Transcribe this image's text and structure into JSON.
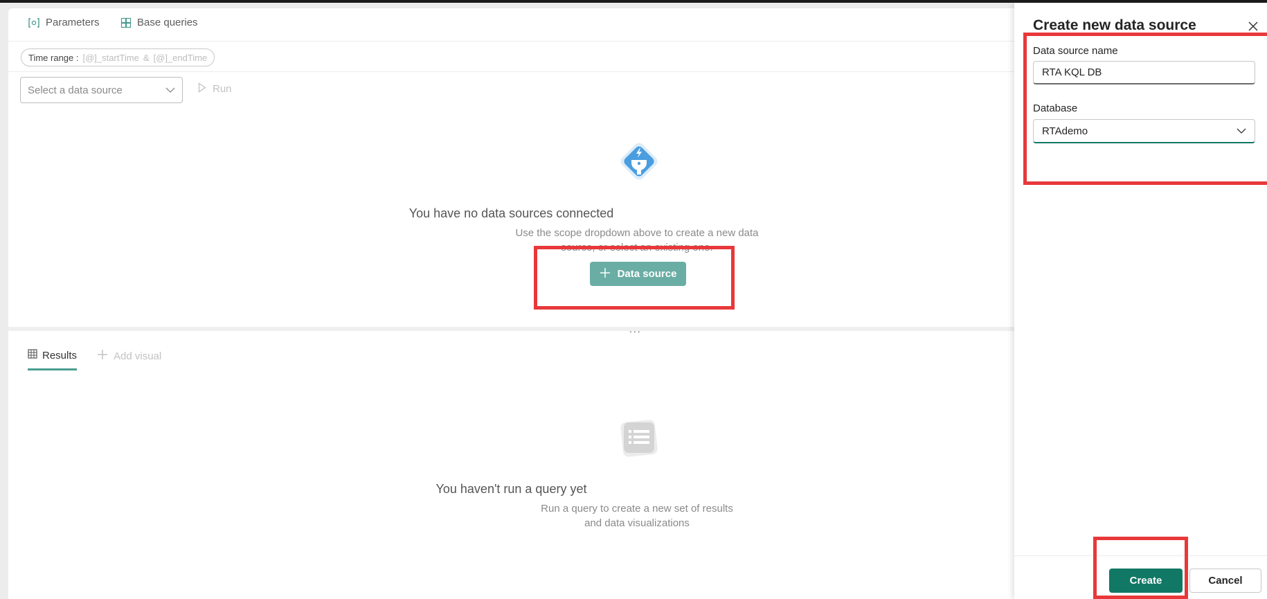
{
  "tabs": {
    "parameters_label": "Parameters",
    "base_queries_label": "Base queries"
  },
  "time_range": {
    "label": "Time range :",
    "start_placeholder": "[@]_startTime",
    "separator": "&",
    "end_placeholder": "[@]_endTime"
  },
  "query": {
    "data_source_placeholder": "Select a data source",
    "run_label": "Run"
  },
  "empty_data": {
    "title": "You have no data sources connected",
    "subtitle": "Use the scope dropdown above to create a new data source, or select an existing one.",
    "button_label": "Data source"
  },
  "splitter_dots": "...",
  "results": {
    "tab_label": "Results",
    "add_visual_label": "Add visual",
    "empty_title": "You haven't run a query yet",
    "empty_subtitle": "Run a query to create a new set of results and data visualizations"
  },
  "panel": {
    "title": "Create new data source",
    "name_label": "Data source name",
    "name_value": "RTA KQL DB",
    "database_label": "Database",
    "database_value": "RTAdemo",
    "create_label": "Create",
    "cancel_label": "Cancel"
  },
  "icons": {
    "parameters": "parameters-icon",
    "base_queries": "base-queries-icon",
    "chevron": "chevron-down-icon",
    "run": "play-icon",
    "plug": "plug-icon",
    "plus": "plus-icon",
    "table": "table-icon",
    "list": "list-icon",
    "close": "close-icon"
  },
  "colors": {
    "accent": "#117865",
    "accent_light": "#6aada4",
    "highlight": "#e8383a",
    "plug_blue": "#4a9ee0"
  }
}
